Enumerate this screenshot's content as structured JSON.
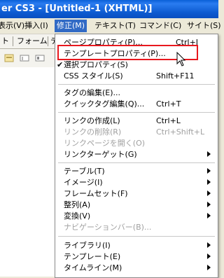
{
  "window": {
    "title": "er CS3 - [Untitled-1 (XHTML)]"
  },
  "menubar": {
    "items": [
      "表示(V)",
      "挿入(I)",
      "修正(M)",
      "テキスト(T)",
      "コマンド(C)",
      "サイト(S)"
    ]
  },
  "tabs": {
    "t1": "ト",
    "t2": "フォーム",
    "t3": "テ"
  },
  "menu": {
    "items": [
      {
        "label": "ページプロパティ(P)...",
        "shortcut": "Ctrl+J"
      },
      {
        "label": "テンプレートプロパティ(P)...",
        "shortcut": ""
      },
      {
        "label": "選択プロパティ(S)",
        "shortcut": ""
      },
      {
        "label": "CSS スタイル(S)",
        "shortcut": "Shift+F11"
      },
      {
        "label": "タグの編集(E)...",
        "shortcut": ""
      },
      {
        "label": "クイックタグ編集(Q)...",
        "shortcut": "Ctrl+T"
      },
      {
        "label": "リンクの作成(L)",
        "shortcut": "Ctrl+L"
      },
      {
        "label": "リンクの削除(R)",
        "shortcut": "Ctrl+Shift+L"
      },
      {
        "label": "リンクページを開く(O)",
        "shortcut": ""
      },
      {
        "label": "リンクターゲット(G)",
        "shortcut": ""
      },
      {
        "label": "テーブル(T)",
        "shortcut": ""
      },
      {
        "label": "イメージ(I)",
        "shortcut": ""
      },
      {
        "label": "フレームセット(F)",
        "shortcut": ""
      },
      {
        "label": "整列(A)",
        "shortcut": ""
      },
      {
        "label": "変換(V)",
        "shortcut": ""
      },
      {
        "label": "ナビゲーションバー(B)...",
        "shortcut": ""
      },
      {
        "label": "ライブラリ(I)",
        "shortcut": ""
      },
      {
        "label": "テンプレート(E)",
        "shortcut": ""
      },
      {
        "label": "タイムライン(M)",
        "shortcut": ""
      }
    ]
  },
  "colors": {
    "menu_active": "#316ac5",
    "highlight_box": "#e8181e",
    "titlebar": "#0a5fd7"
  }
}
